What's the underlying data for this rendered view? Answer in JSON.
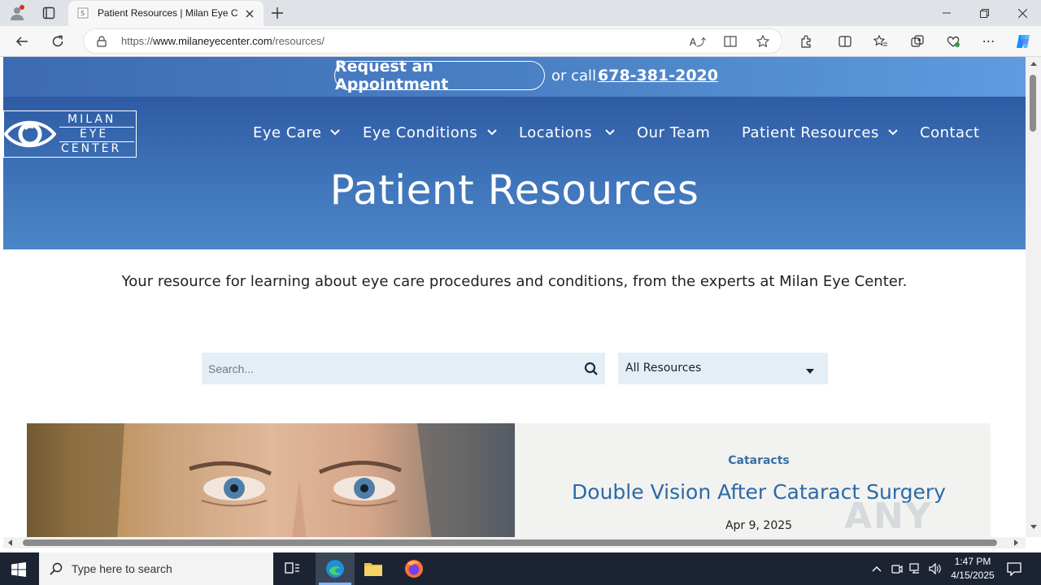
{
  "browser": {
    "tab_title": "Patient Resources | Milan Eye Cen",
    "url_prefix": "https://",
    "url_domain": "www.milaneyecenter.com",
    "url_path": "/resources/"
  },
  "site": {
    "appointment_label": "Request an Appointment",
    "or_call": "or call",
    "phone": "678-381-2020",
    "logo_line1": "MILAN",
    "logo_line2": "EYE",
    "logo_line3": "CENTER",
    "nav": [
      {
        "label": "Eye Care"
      },
      {
        "label": "Eye Conditions"
      },
      {
        "label": "Locations"
      },
      {
        "label": "Our Team"
      },
      {
        "label": "Patient Resources"
      },
      {
        "label": "Contact"
      }
    ],
    "hero_title": "Patient Resources"
  },
  "content": {
    "intro": "Your resource for learning about eye care procedures and conditions, from the experts at Milan Eye Center.",
    "search_placeholder": "Search...",
    "filter_selected": "All Resources",
    "card": {
      "category": "Cataracts",
      "title": "Double Vision After Cataract Surgery",
      "date": "Apr 9, 2025"
    },
    "watermark": "ANY RUN"
  },
  "taskbar": {
    "search_placeholder": "Type here to search",
    "time": "1:47 PM",
    "date": "4/15/2025"
  },
  "colors": {
    "brand_blue": "#3e72b8",
    "card_blue": "#2a6aa8",
    "taskbar": "#1c2433"
  }
}
